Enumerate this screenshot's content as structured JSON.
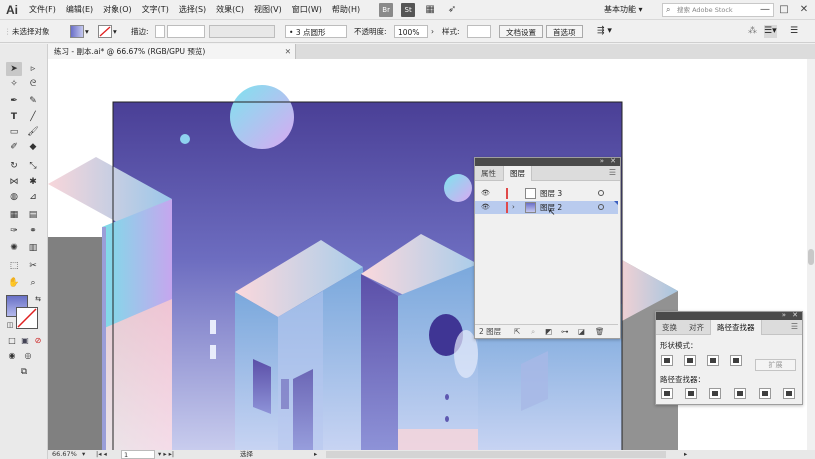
{
  "app": {
    "logo": "Ai"
  },
  "menu": [
    "文件(F)",
    "编辑(E)",
    "对象(O)",
    "文字(T)",
    "选择(S)",
    "效果(C)",
    "视图(V)",
    "窗口(W)",
    "帮助(H)"
  ],
  "menubar_icons": {
    "bridge": "Br",
    "stock": "St"
  },
  "workspace": {
    "label": "基本功能"
  },
  "search": {
    "placeholder": "搜索 Adobe Stock"
  },
  "window_controls": {
    "minimize": "—",
    "maximize": "□",
    "close": "✕"
  },
  "control_bar": {
    "selection_status": "未选择对象",
    "stroke_label": "描边:",
    "stroke_style": "3 点圆形",
    "opacity_label": "不透明度:",
    "opacity_value": "100%",
    "style_label": "样式:",
    "doc_setup_button": "文档设置",
    "preferences_button": "首选项"
  },
  "document_tab": {
    "title": "练习 - 副本.ai* @ 66.67% (RGB/GPU 预览)",
    "close": "✕"
  },
  "status_bar": {
    "zoom": "66.67%",
    "artboard": "1",
    "tool": "选择"
  },
  "layers_panel": {
    "tabs": [
      "属性",
      "图层"
    ],
    "active_tab": "图层",
    "layers": [
      {
        "name": "图层 3",
        "selected": false
      },
      {
        "name": "图层 2",
        "selected": true
      }
    ],
    "footer_count": "2 图层"
  },
  "pathfinder_panel": {
    "tabs": [
      "变换",
      "对齐",
      "路径查找器"
    ],
    "active_tab": "路径查找器",
    "shape_modes_label": "形状模式：",
    "expand_button": "扩展",
    "pathfinders_label": "路径查找器："
  },
  "colors": {
    "sky_top": "#4a3f96",
    "sky_bottom": "#c9cdee",
    "accent_pink": "#f8d3d8",
    "accent_cyan": "#7ee3ee",
    "layer_color": "#e04a4a",
    "layer_selected": "#b9cbee"
  }
}
